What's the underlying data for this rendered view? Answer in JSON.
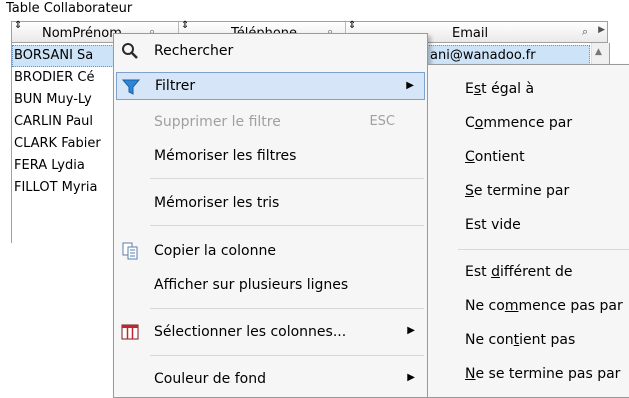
{
  "table_title": "Table Collaborateur",
  "columns": {
    "nom": "NomPrénom",
    "tel": "Téléphone",
    "mail": "Email"
  },
  "sort_glyph": "⇕",
  "rows": [
    {
      "nom": "BORSANI Sa",
      "mail": "ani@wanadoo.fr"
    },
    {
      "nom": "BRODIER Cé",
      "mail": ""
    },
    {
      "nom": "BUN Muy-Ly",
      "mail": ""
    },
    {
      "nom": "CARLIN Paul",
      "mail": ""
    },
    {
      "nom": "CLARK Fabier",
      "mail": ""
    },
    {
      "nom": "FERA Lydia",
      "mail": ""
    },
    {
      "nom": "FILLOT Myria",
      "mail": ""
    }
  ],
  "menu": {
    "rechercher": "Rechercher",
    "filtrer": "Filtrer",
    "supprimer_filtre": "Supprimer le filtre",
    "supprimer_shortcut": "ESC",
    "memoriser_filtres": "Mémoriser les filtres",
    "memoriser_tris": "Mémoriser les tris",
    "copier_colonne": "Copier la colonne",
    "plusieurs_lignes": "Afficher sur plusieurs lignes",
    "selectionner_colonnes": "Sélectionner les colonnes...",
    "couleur_fond": "Couleur de fond"
  },
  "submenu": {
    "est_egal": {
      "pre": "E",
      "u": "s",
      "post": "t égal à"
    },
    "commence_par": {
      "pre": "C",
      "u": "o",
      "post": "mmence par"
    },
    "contient": {
      "pre": "",
      "u": "C",
      "post": "ontient"
    },
    "se_termine": {
      "pre": "",
      "u": "S",
      "post": "e termine par"
    },
    "est_vide": {
      "pre": "Est vide",
      "u": "",
      "post": ""
    },
    "est_different": {
      "pre": "Est ",
      "u": "d",
      "post": "ifférent de"
    },
    "ne_commence": {
      "pre": "Ne co",
      "u": "m",
      "post": "mence pas par"
    },
    "ne_contient": {
      "pre": "Ne con",
      "u": "t",
      "post": "ient pas"
    },
    "ne_se_termine": {
      "pre": "",
      "u": "N",
      "post": "e se termine pas par"
    }
  },
  "icons": {
    "search": "search-icon",
    "filter": "funnel-icon",
    "copy": "copy-icon",
    "columns": "columns-icon"
  },
  "colors": {
    "hover_bg": "#d6e6f8",
    "selection_bg": "#cde3f7",
    "funnel": "#2f86d6",
    "columns_icon": "#c0262c"
  }
}
